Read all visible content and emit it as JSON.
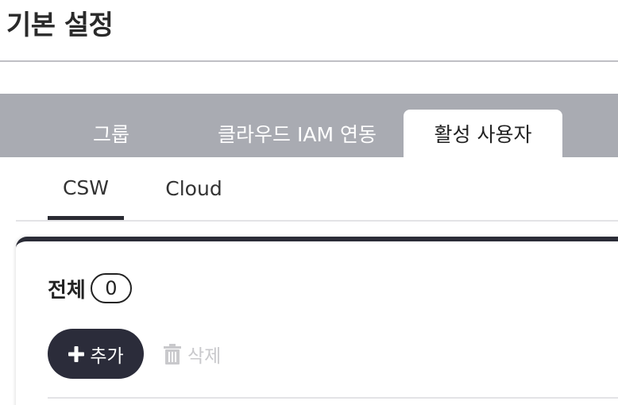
{
  "page": {
    "title": "기본 설정"
  },
  "tabs": [
    {
      "label": "그룹",
      "active": false
    },
    {
      "label": "클라우드 IAM 연동",
      "active": false
    },
    {
      "label": "활성 사용자",
      "active": true
    }
  ],
  "subtabs": [
    {
      "label": "CSW",
      "active": true
    },
    {
      "label": "Cloud",
      "active": false
    }
  ],
  "summary": {
    "total_label": "전체",
    "total_count": "0"
  },
  "toolbar": {
    "add_label": "추가",
    "add_icon": "plus-icon",
    "delete_label": "삭제",
    "delete_icon": "trash-icon",
    "delete_disabled": true
  },
  "colors": {
    "tabbar_bg": "#a9abb2",
    "primary_dark": "#2b2c3a",
    "disabled_text": "#c9c9cc"
  }
}
